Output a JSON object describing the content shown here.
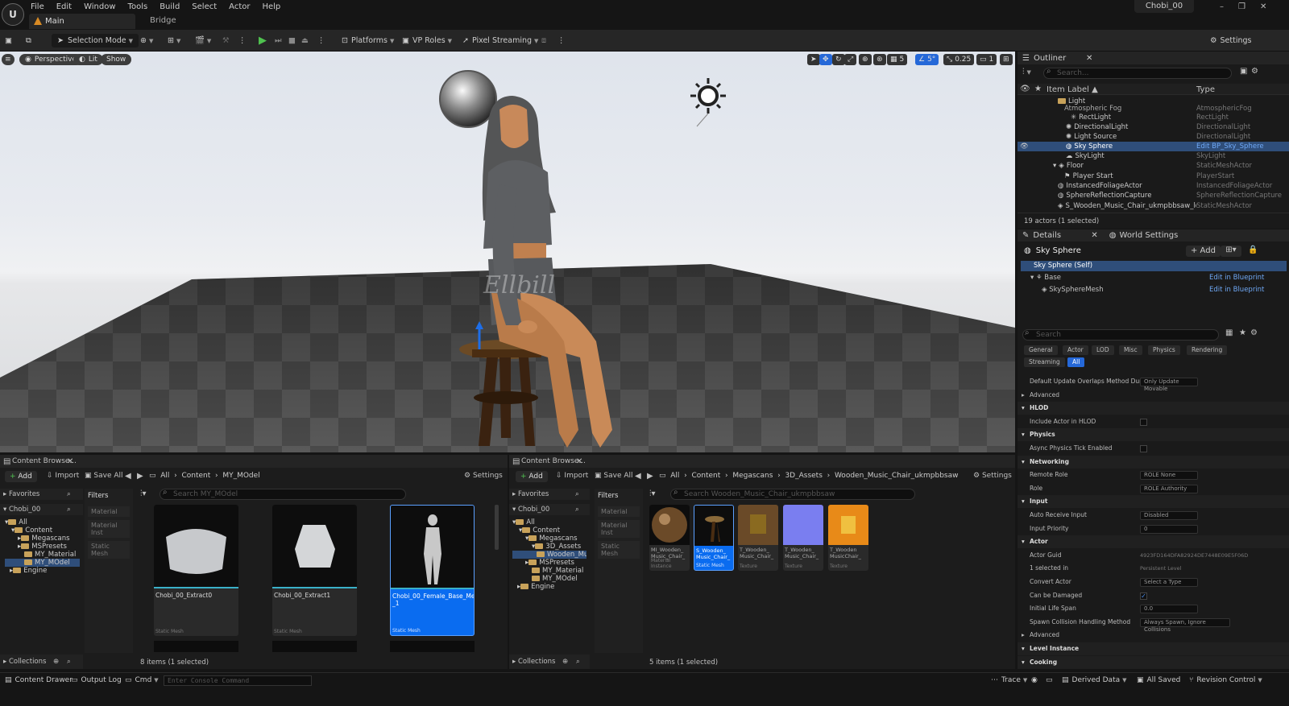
{
  "menubar": {
    "items": [
      "File",
      "Edit",
      "Window",
      "Tools",
      "Build",
      "Select",
      "Actor",
      "Help"
    ],
    "project": "Chobi_00",
    "tabs": {
      "main": "Main",
      "bridge": "Bridge"
    }
  },
  "toolbar": {
    "selection_mode": "Selection Mode",
    "platforms": "Platforms",
    "vp_roles": "VP Roles",
    "pixel_streaming": "Pixel Streaming",
    "settings": "Settings"
  },
  "viewport": {
    "perspective": "Perspective",
    "lit": "Lit",
    "show": "Show",
    "grid_snap": "5",
    "angle_snap": "5°",
    "scale_snap": "0.25",
    "cam_speed": "1",
    "watermark": "Ellbill"
  },
  "outliner": {
    "title": "Outliner",
    "search": "Search...",
    "col_label": "Item Label ▲",
    "col_type": "Type",
    "status": "19 actors (1 selected)",
    "rows": [
      {
        "label": "Light",
        "type": ""
      },
      {
        "label": "Atmospheric Fog",
        "type": "AtmosphericFog"
      },
      {
        "label": "RectLight",
        "type": "RectLight"
      },
      {
        "label": "DirectionalLight",
        "type": "DirectionalLight"
      },
      {
        "label": "Light Source",
        "type": "DirectionalLight"
      },
      {
        "label": "Sky Sphere",
        "type": "Edit BP_Sky_Sphere"
      },
      {
        "label": "SkyLight",
        "type": "SkyLight"
      },
      {
        "label": "Floor",
        "type": "StaticMeshActor"
      },
      {
        "label": "Player Start",
        "type": "PlayerStart"
      },
      {
        "label": "InstancedFoliageActor",
        "type": "InstancedFoliageActor"
      },
      {
        "label": "SphereReflectionCapture",
        "type": "SphereReflectionCapture"
      },
      {
        "label": "S_Wooden_Music_Chair_ukmpbbsaw_lod0_",
        "type": "StaticMeshActor"
      }
    ]
  },
  "details": {
    "title": "Details",
    "world_settings": "World Settings",
    "actor": "Sky Sphere",
    "add": "+ Add",
    "self": "Sky Sphere (Self)",
    "base": "Base",
    "mesh": "SkySphereMesh",
    "edit_bp": "Edit in Blueprint",
    "search": "Search",
    "filters": [
      "General",
      "Actor",
      "LOD",
      "Misc",
      "Physics",
      "Rendering",
      "Streaming",
      "All"
    ],
    "props": [
      {
        "k": "Default Update Overlaps Method During L...",
        "v": "Only Update Movable",
        "t": "dd"
      },
      {
        "k": "Advanced",
        "t": "sub"
      },
      {
        "k": "HLOD",
        "t": "sect"
      },
      {
        "k": "Include Actor in HLOD",
        "t": "cb"
      },
      {
        "k": "Physics",
        "t": "sect"
      },
      {
        "k": "Async Physics Tick Enabled",
        "t": "cb"
      },
      {
        "k": "Networking",
        "t": "sect"
      },
      {
        "k": "Remote Role",
        "v": "ROLE None",
        "t": "dd"
      },
      {
        "k": "Role",
        "v": "ROLE Authority",
        "t": "dd"
      },
      {
        "k": "Input",
        "t": "sect"
      },
      {
        "k": "Auto Receive Input",
        "v": "Disabled",
        "t": "dd"
      },
      {
        "k": "Input Priority",
        "v": "0",
        "t": "in"
      },
      {
        "k": "Actor",
        "t": "sect"
      },
      {
        "k": "Actor Guid",
        "v": "4923FD164DFA82924DE7448E09E5F06D",
        "t": "txt"
      },
      {
        "k": "1 selected in",
        "v": "Persistent Level",
        "t": "txt"
      },
      {
        "k": "Convert Actor",
        "v": "Select a Type",
        "t": "dd"
      },
      {
        "k": "Can be Damaged",
        "t": "cbon"
      },
      {
        "k": "Initial Life Span",
        "v": "0.0",
        "t": "in"
      },
      {
        "k": "Spawn Collision Handling Method",
        "v": "Always Spawn, Ignore Collisions",
        "t": "dd"
      },
      {
        "k": "Advanced",
        "t": "sub"
      },
      {
        "k": "Level Instance",
        "t": "sect"
      },
      {
        "k": "Cooking",
        "t": "sect"
      }
    ]
  },
  "cb1": {
    "title": "Content Browse...",
    "add": "Add",
    "import": "Import",
    "save_all": "Save All",
    "settings": "Settings",
    "crumbs": [
      "All",
      "Content",
      "MY_MOdel"
    ],
    "favorites": "Favorites",
    "project": "Chobi_00",
    "filters": "Filters",
    "search": "Search MY_MOdel",
    "tree": [
      "All",
      "Content",
      "Megascans",
      "MSPresets",
      "MY_Material",
      "MY_MOdel",
      "Engine"
    ],
    "filter_items": [
      "Material",
      "Material Inst",
      "Static Mesh"
    ],
    "assets": [
      {
        "name": "Chobi_00_Extract0",
        "type": "Static Mesh"
      },
      {
        "name": "Chobi_00_Extract1",
        "type": "Static Mesh"
      },
      {
        "name": "Chobi_00_Female_Base_Mesh1\n_1",
        "type": "Static Mesh"
      }
    ],
    "status": "8 items (1 selected)",
    "collections": "Collections"
  },
  "cb2": {
    "title": "Content Browse...",
    "add": "Add",
    "import": "Import",
    "save_all": "Save All",
    "settings": "Settings",
    "crumbs": [
      "All",
      "Content",
      "Megascans",
      "3D_Assets",
      "Wooden_Music_Chair_ukmpbbsaw"
    ],
    "favorites": "Favorites",
    "project": "Chobi_00",
    "filters": "Filters",
    "search": "Search Wooden_Music_Chair_ukmpbbsaw",
    "tree": [
      "All",
      "Content",
      "Megascans",
      "3D_Assets",
      "Wooden_Musi",
      "MSPresets",
      "MY_Material",
      "MY_MOdel",
      "Engine"
    ],
    "filter_items": [
      "Material",
      "Material Inst",
      "Static Mesh"
    ],
    "assets": [
      {
        "name": "MI_Wooden_\nMusic_Chair_",
        "type": "Material Instance"
      },
      {
        "name": "S_Wooden_\nMusic_Chair_",
        "type": "Static Mesh"
      },
      {
        "name": "T_Wooden_\nMusic_Chair_",
        "type": "Texture"
      },
      {
        "name": "T_Wooden_\nMusic_Chair_",
        "type": "Texture"
      },
      {
        "name": "T_Wooden\nMusicChair_",
        "type": "Texture"
      }
    ],
    "status": "5 items (1 selected)",
    "collections": "Collections"
  },
  "statusbar": {
    "content_drawer": "Content Drawer",
    "output_log": "Output Log",
    "cmd": "Cmd",
    "console": "Enter Console Command",
    "trace": "Trace",
    "derived": "Derived Data",
    "saved": "All Saved",
    "revision": "Revision Control"
  }
}
